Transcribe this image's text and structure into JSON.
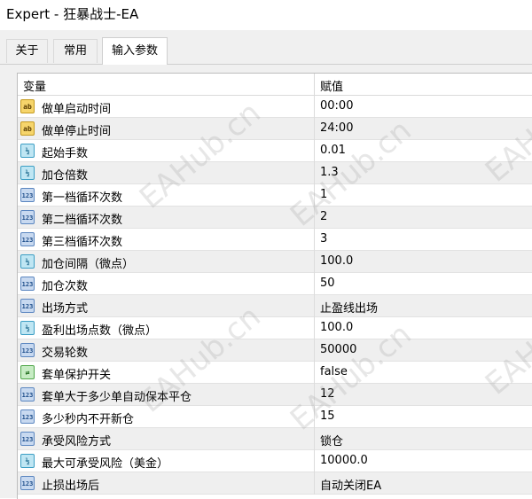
{
  "window": {
    "title": "Expert - 狂暴战士-EA"
  },
  "tabs": [
    {
      "label": "关于"
    },
    {
      "label": "常用"
    },
    {
      "label": "输入参数"
    }
  ],
  "table": {
    "headers": {
      "variable": "变量",
      "value": "赋值"
    },
    "rows": [
      {
        "icon": "string-icon",
        "type_label": "ab",
        "name": "做单启动时间",
        "value": "00:00"
      },
      {
        "icon": "string-icon",
        "type_label": "ab",
        "name": "做单停止时间",
        "value": "24:00"
      },
      {
        "icon": "double-icon",
        "type_label": "½",
        "name": "起始手数",
        "value": "0.01"
      },
      {
        "icon": "double-icon",
        "type_label": "½",
        "name": "加仓倍数",
        "value": "1.3"
      },
      {
        "icon": "integer-icon",
        "type_label": "123",
        "name": "第一档循环次数",
        "value": "1"
      },
      {
        "icon": "integer-icon",
        "type_label": "123",
        "name": "第二档循环次数",
        "value": "2"
      },
      {
        "icon": "integer-icon",
        "type_label": "123",
        "name": "第三档循环次数",
        "value": "3"
      },
      {
        "icon": "double-icon",
        "type_label": "½",
        "name": "加仓间隔（微点）",
        "value": "100.0"
      },
      {
        "icon": "integer-icon",
        "type_label": "123",
        "name": "加仓次数",
        "value": "50"
      },
      {
        "icon": "integer-icon",
        "type_label": "123",
        "name": "出场方式",
        "value": "止盈线出场"
      },
      {
        "icon": "double-icon",
        "type_label": "½",
        "name": "盈利出场点数（微点）",
        "value": "100.0"
      },
      {
        "icon": "integer-icon",
        "type_label": "123",
        "name": "交易轮数",
        "value": "50000"
      },
      {
        "icon": "bool-icon",
        "type_label": "⇄",
        "name": "套单保护开关",
        "value": "false"
      },
      {
        "icon": "integer-icon",
        "type_label": "123",
        "name": "套单大于多少单自动保本平仓",
        "value": "12"
      },
      {
        "icon": "integer-icon",
        "type_label": "123",
        "name": "多少秒内不开新仓",
        "value": "15"
      },
      {
        "icon": "integer-icon",
        "type_label": "123",
        "name": "承受风险方式",
        "value": "锁仓"
      },
      {
        "icon": "double-icon",
        "type_label": "½",
        "name": "最大可承受风险（美金）",
        "value": "10000.0"
      },
      {
        "icon": "integer-icon",
        "type_label": "123",
        "name": "止损出场后",
        "value": "自动关闭EA"
      }
    ]
  },
  "watermark": "EAHub.cn"
}
